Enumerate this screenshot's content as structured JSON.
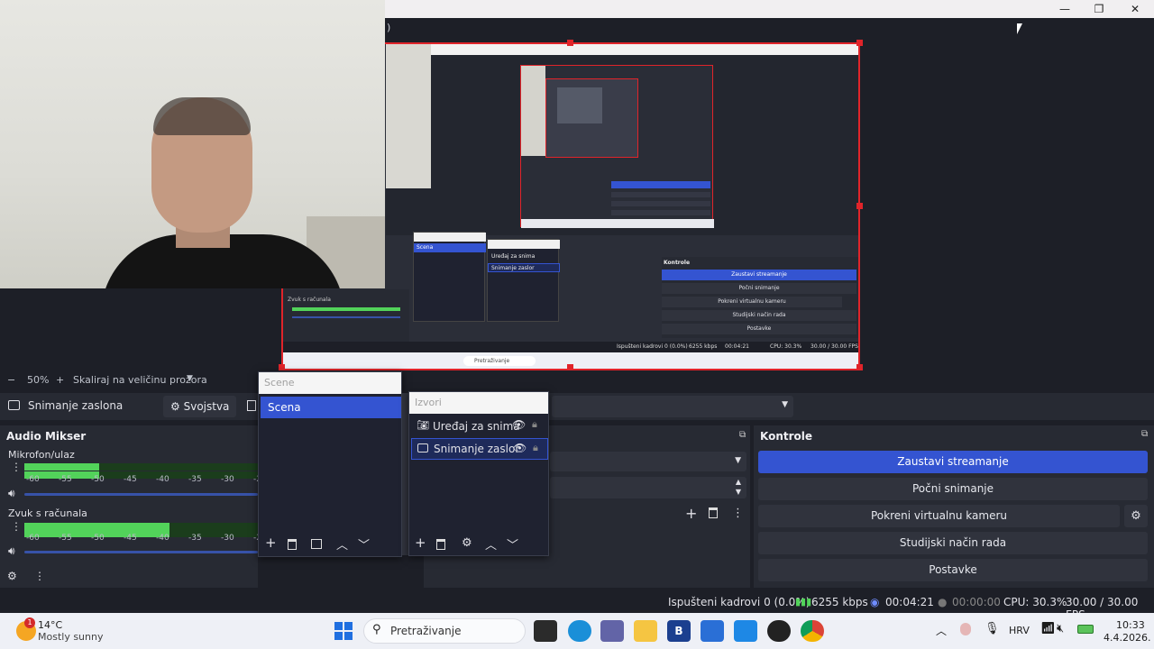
{
  "window": {
    "title_fragment": ")",
    "minimize_glyph": "—",
    "restore_glyph": "❐",
    "close_glyph": "✕"
  },
  "preview": {
    "zoom_minus": "−",
    "zoom": "50%",
    "zoom_plus": "+",
    "scale_mode": "Skaliraj na veličinu prozora",
    "nested": {
      "scenes_label": "Scena",
      "sources_item_1": "Uređaj za snima",
      "sources_item_2": "Snimanje zaslor",
      "controls_title": "Kontrole",
      "controls_1": "Zaustavi streamanje",
      "controls_2": "Počni snimanje",
      "controls_3": "Pokreni virtualnu kameru",
      "controls_4": "Studijski način rada",
      "controls_5": "Postavke",
      "mixer_item": "Zvuk s računala",
      "status": "Ispušteni kadrovi 0 (0.0%)",
      "kbps": "6255 kbps",
      "time": "00:04:21",
      "cpu": "CPU: 30.3%",
      "fps": "30.00 / 30.00 FPS",
      "search": "Pretraživanje"
    }
  },
  "source_toolbar": {
    "selected_source": "Snimanje zaslona",
    "properties": "Svojstva"
  },
  "audio_mixer": {
    "title": "Audio Mikser",
    "tracks": [
      {
        "name": "Mikrofon/ulaz",
        "level": 0.32
      },
      {
        "name": "Zvuk s računala",
        "level": 0.62
      }
    ],
    "scale": [
      "-60",
      "-55",
      "-50",
      "-45",
      "-40",
      "-35",
      "-30",
      "-25"
    ]
  },
  "scenes": {
    "header_placeholder": "Scene",
    "items": [
      "Scena"
    ]
  },
  "sources": {
    "header_placeholder": "Izvori",
    "items": [
      "Uređaj za snima",
      "Snimanje zaslor"
    ]
  },
  "controls": {
    "title": "Kontrole",
    "buttons": [
      "Zaustavi streamanje",
      "Počni snimanje",
      "Pokreni virtualnu kameru",
      "Studijski način rada",
      "Postavke"
    ]
  },
  "status": {
    "dropped": "Ispušteni kadrovi 0 (0.0%)",
    "kbps": "6255 kbps",
    "stream_time": "00:04:21",
    "rec_time": "00:00:00",
    "cpu": "CPU: 30.3%",
    "fps": "30.00 / 30.00 FPS"
  },
  "taskbar": {
    "weather_temp": "14°C",
    "weather_desc": "Mostly sunny",
    "weather_badge": "1",
    "search_placeholder": "Pretraživanje",
    "language": "HRV",
    "time": "10:33",
    "date": "4.4.2026.",
    "app_b_letter": "B"
  },
  "colors": {
    "accent": "#3454d1",
    "selection_border": "#e0242a",
    "meter_green": "#52d35a",
    "background": "#1d1f27",
    "dock": "#272a33"
  }
}
